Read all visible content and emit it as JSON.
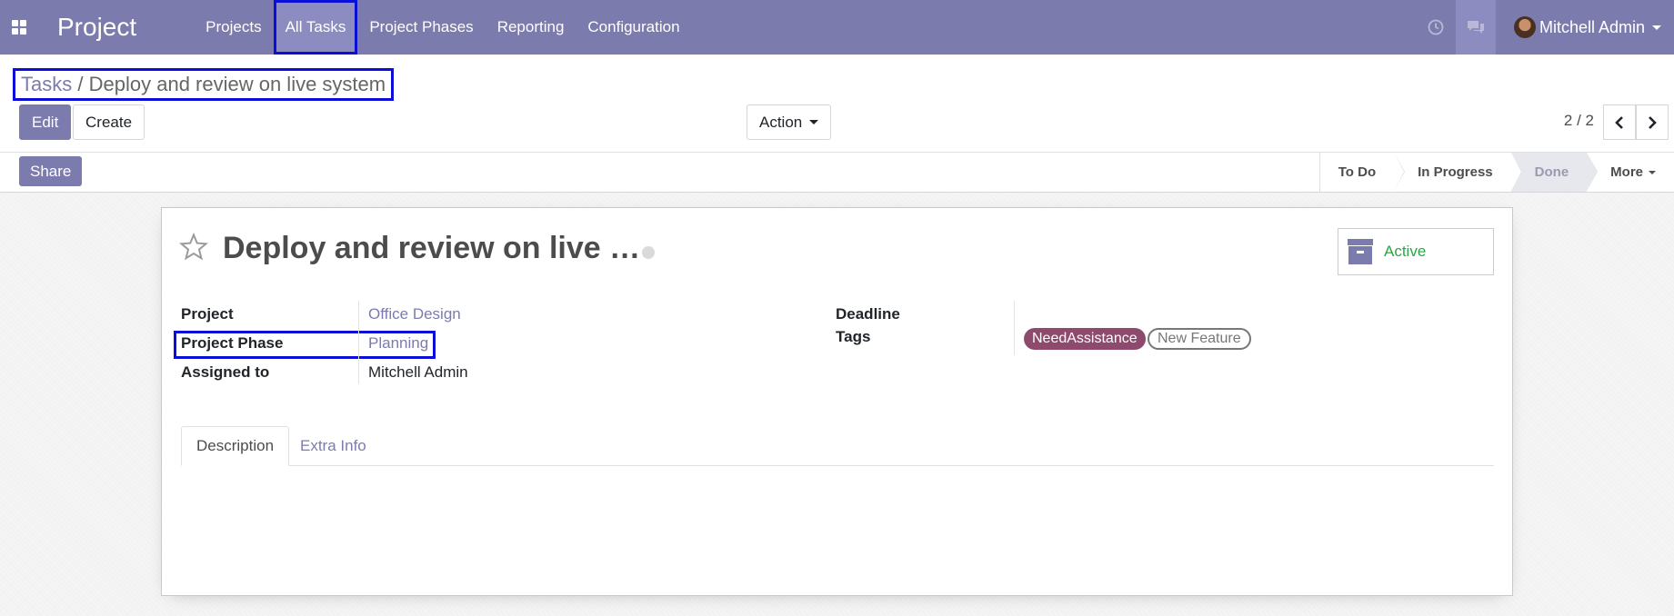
{
  "navbar": {
    "brand": "Project",
    "menu": [
      "Projects",
      "All Tasks",
      "Project Phases",
      "Reporting",
      "Configuration"
    ],
    "user_name": "Mitchell Admin"
  },
  "control": {
    "breadcrumb_parent": "Tasks",
    "breadcrumb_separator": "/",
    "breadcrumb_current": "Deploy and review on live system",
    "edit_label": "Edit",
    "create_label": "Create",
    "action_label": "Action",
    "pager_value": "2 / 2"
  },
  "statusbar": {
    "share_label": "Share",
    "stages": [
      "To Do",
      "In Progress",
      "Done"
    ],
    "current_stage": "Done",
    "more_label": "More"
  },
  "form": {
    "title": "Deploy and review on live …",
    "active_label": "Active",
    "project_label": "Project",
    "project_value": "Office Design",
    "phase_label": "Project Phase",
    "phase_value": "Planning",
    "assigned_label": "Assigned to",
    "assigned_value": "Mitchell Admin",
    "deadline_label": "Deadline",
    "tags_label": "Tags",
    "tags": [
      "NeedAssistance",
      "New Feature"
    ],
    "tabs": [
      "Description",
      "Extra Info"
    ]
  },
  "colors": {
    "brand": "#7c7bad",
    "highlight": "#0a0ed6",
    "tag_need_assistance": "#8e4a6c",
    "active_green": "#28a745"
  }
}
